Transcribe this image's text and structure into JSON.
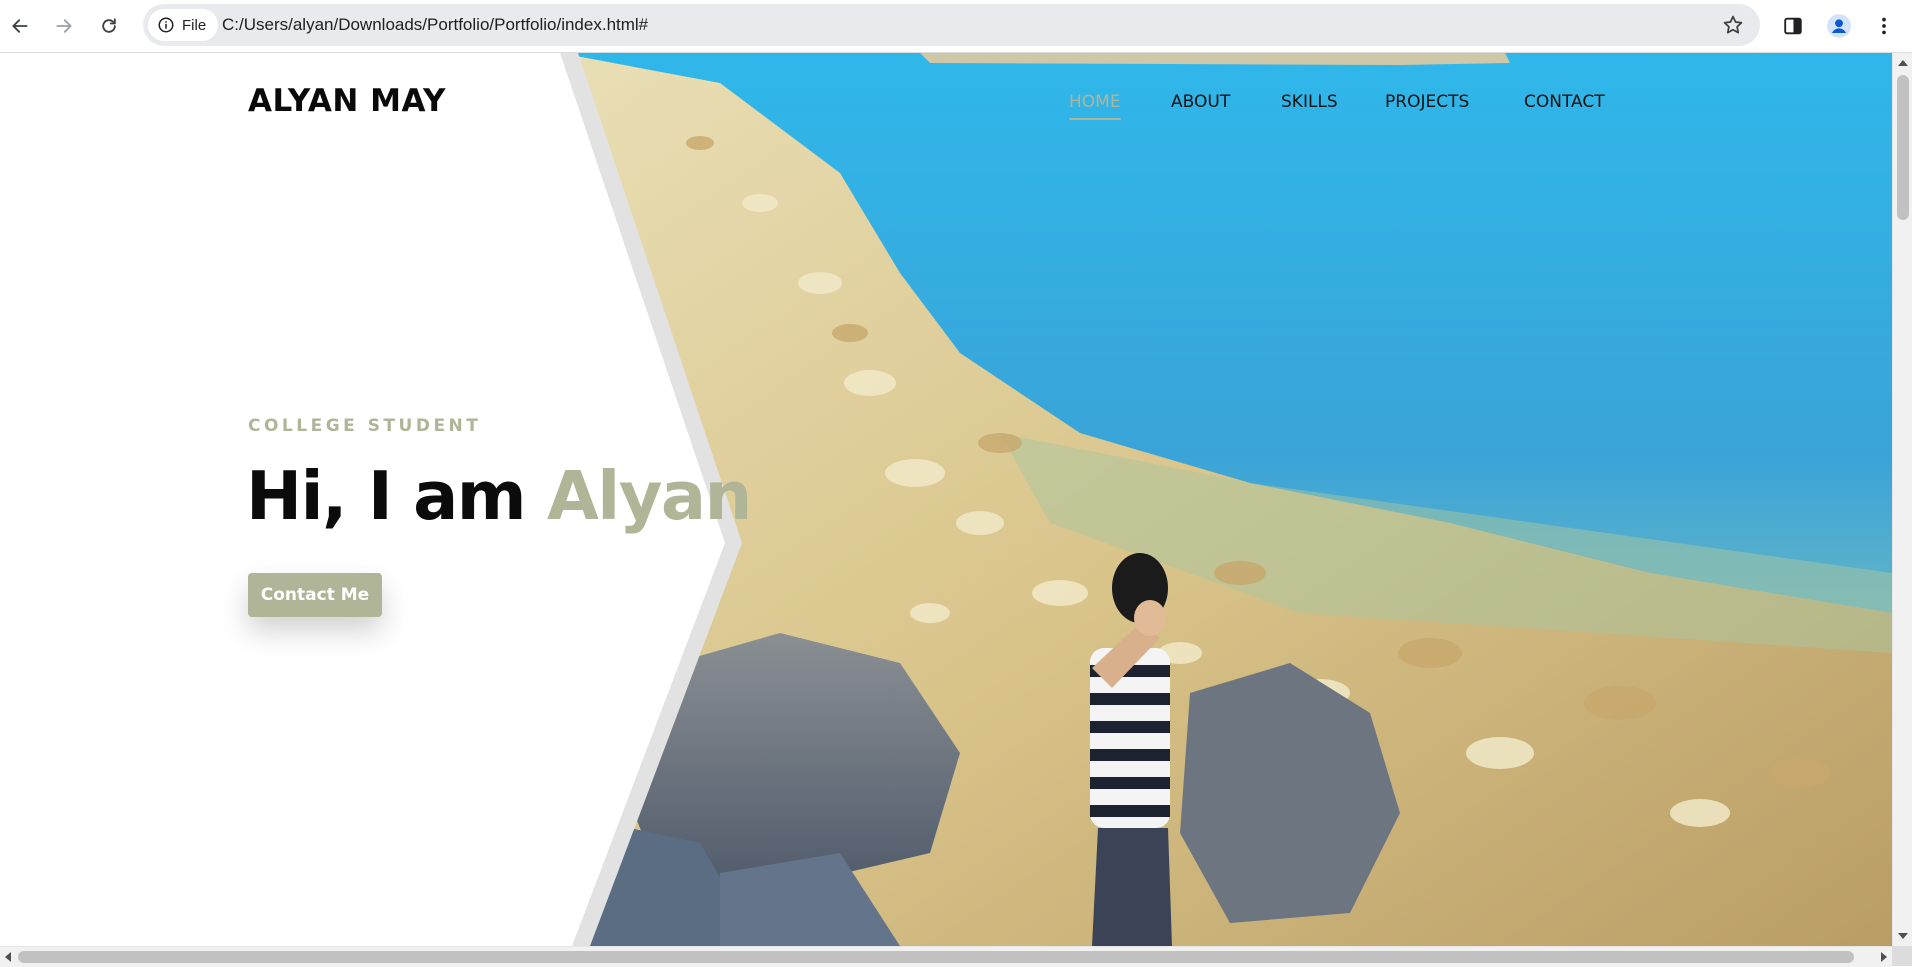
{
  "browser": {
    "back_icon": "arrow-left-icon",
    "forward_icon": "arrow-right-icon",
    "reload_icon": "reload-icon",
    "site_info_label": "File",
    "site_info_icon": "info-icon",
    "url": "C:/Users/alyan/Downloads/Portfolio/Portfolio/index.html#",
    "bookmark_icon": "star-icon",
    "side_panel_icon": "side-panel-icon",
    "profile_icon": "profile-icon",
    "menu_icon": "kebab-menu-icon"
  },
  "header": {
    "logo": "ALYAN MAY",
    "nav": [
      {
        "label": "HOME",
        "active": true
      },
      {
        "label": "ABOUT",
        "active": false
      },
      {
        "label": "SKILLS",
        "active": false
      },
      {
        "label": "PROJECTS",
        "active": false
      },
      {
        "label": "CONTACT",
        "active": false
      }
    ]
  },
  "hero": {
    "eyebrow": "COLLEGE STUDENT",
    "headline_prefix": "Hi, I am",
    "headline_name": "Alyan",
    "cta_label": "Contact Me"
  },
  "colors": {
    "accent": "#b0b597",
    "text_dark": "#0b0b0b",
    "background": "#ffffff",
    "water": "#3aa8d8"
  }
}
